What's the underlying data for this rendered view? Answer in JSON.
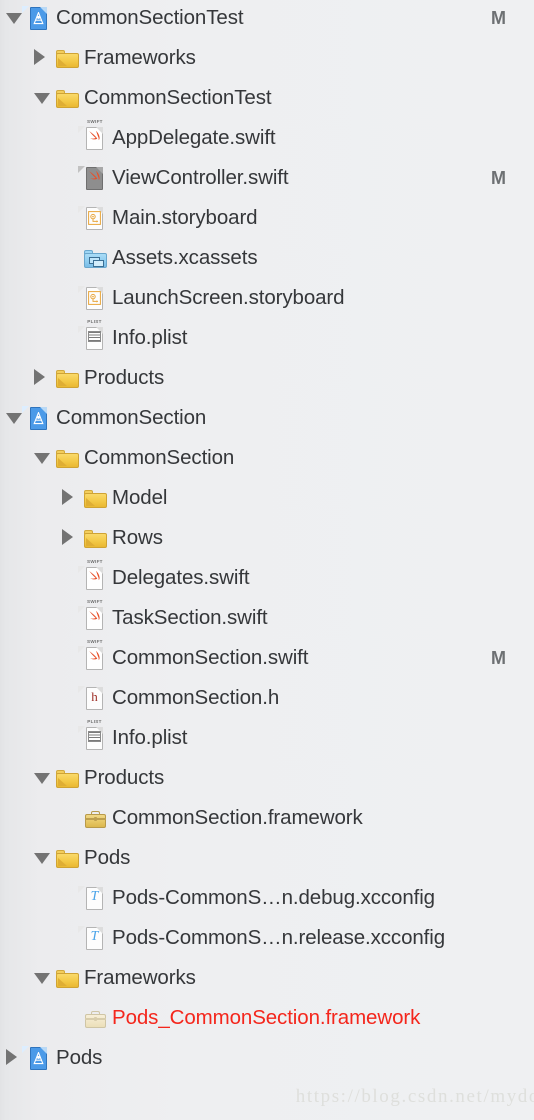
{
  "watermark": "https://blog.csdn.net/mydo",
  "rows": [
    {
      "label": "CommonSectionTest",
      "icon": "xcode-project-icon",
      "depth": 0,
      "twisty": "open",
      "status": "M"
    },
    {
      "label": "Frameworks",
      "icon": "folder-icon",
      "depth": 1,
      "twisty": "closed",
      "status": ""
    },
    {
      "label": "CommonSectionTest",
      "icon": "folder-icon",
      "depth": 1,
      "twisty": "open",
      "status": ""
    },
    {
      "label": "AppDelegate.swift",
      "icon": "swift-file-icon",
      "depth": 2,
      "twisty": "none",
      "status": ""
    },
    {
      "label": "ViewController.swift",
      "icon": "swift-file-icon-dimmed",
      "depth": 2,
      "twisty": "none",
      "status": "M"
    },
    {
      "label": "Main.storyboard",
      "icon": "storyboard-icon",
      "depth": 2,
      "twisty": "none",
      "status": ""
    },
    {
      "label": "Assets.xcassets",
      "icon": "xcassets-folder-icon",
      "depth": 2,
      "twisty": "none",
      "status": ""
    },
    {
      "label": "LaunchScreen.storyboard",
      "icon": "storyboard-icon",
      "depth": 2,
      "twisty": "none",
      "status": ""
    },
    {
      "label": "Info.plist",
      "icon": "plist-icon",
      "depth": 2,
      "twisty": "none",
      "status": ""
    },
    {
      "label": "Products",
      "icon": "folder-icon",
      "depth": 1,
      "twisty": "closed",
      "status": ""
    },
    {
      "label": "CommonSection",
      "icon": "xcode-project-icon",
      "depth": 0,
      "twisty": "open",
      "status": ""
    },
    {
      "label": "CommonSection",
      "icon": "folder-icon",
      "depth": 1,
      "twisty": "open",
      "status": ""
    },
    {
      "label": "Model",
      "icon": "folder-icon",
      "depth": 2,
      "twisty": "closed",
      "status": ""
    },
    {
      "label": "Rows",
      "icon": "folder-icon",
      "depth": 2,
      "twisty": "closed",
      "status": ""
    },
    {
      "label": "Delegates.swift",
      "icon": "swift-file-icon",
      "depth": 2,
      "twisty": "none",
      "status": ""
    },
    {
      "label": "TaskSection.swift",
      "icon": "swift-file-icon",
      "depth": 2,
      "twisty": "none",
      "status": ""
    },
    {
      "label": "CommonSection.swift",
      "icon": "swift-file-icon",
      "depth": 2,
      "twisty": "none",
      "status": "M"
    },
    {
      "label": "CommonSection.h",
      "icon": "header-file-icon",
      "depth": 2,
      "twisty": "none",
      "status": ""
    },
    {
      "label": "Info.plist",
      "icon": "plist-icon",
      "depth": 2,
      "twisty": "none",
      "status": ""
    },
    {
      "label": "Products",
      "icon": "folder-icon",
      "depth": 1,
      "twisty": "open",
      "status": ""
    },
    {
      "label": "CommonSection.framework",
      "icon": "framework-icon",
      "depth": 2,
      "twisty": "none",
      "status": ""
    },
    {
      "label": "Pods",
      "icon": "folder-icon",
      "depth": 1,
      "twisty": "open",
      "status": ""
    },
    {
      "label": "Pods-CommonS…n.debug.xcconfig",
      "icon": "xcconfig-icon",
      "depth": 2,
      "twisty": "none",
      "status": ""
    },
    {
      "label": "Pods-CommonS…n.release.xcconfig",
      "icon": "xcconfig-icon",
      "depth": 2,
      "twisty": "none",
      "status": ""
    },
    {
      "label": "Frameworks",
      "icon": "folder-icon",
      "depth": 1,
      "twisty": "open",
      "status": ""
    },
    {
      "label": "Pods_CommonSection.framework",
      "icon": "framework-icon-missing",
      "depth": 2,
      "twisty": "none",
      "status": "",
      "missing": true
    },
    {
      "label": "Pods",
      "icon": "xcode-project-icon",
      "depth": 0,
      "twisty": "closed",
      "status": ""
    }
  ],
  "colors": {
    "missing_text": "#f4261c",
    "text": "#35373a",
    "status_badge": "#6d7073",
    "folder": "#f3c947",
    "project_icon": "#4b9ae8",
    "background": "#eeeff1"
  }
}
